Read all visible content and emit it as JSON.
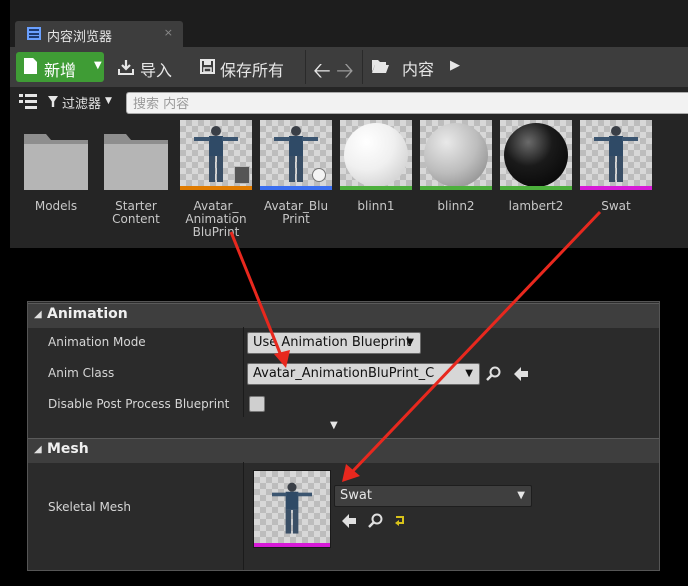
{
  "content_browser": {
    "tab_label": "内容浏览器",
    "tab_close": "×",
    "toolbar": {
      "new_label": "新增",
      "import_label": "导入",
      "save_all_label": "保存所有",
      "back_glyph": "🡠",
      "forward_glyph": "🡢",
      "breadcrumb_root": "内容",
      "breadcrumb_arrow": "▶"
    },
    "filterbar": {
      "filters_label": "过滤器",
      "search_placeholder": "搜索 内容"
    },
    "assets": [
      {
        "name": "Models",
        "kind": "folder"
      },
      {
        "name": "Starter Content",
        "kind": "folder"
      },
      {
        "name": "Avatar_ Animation BluPrint",
        "kind": "animation-blueprint",
        "underline_color": "#e07b00"
      },
      {
        "name": "Avatar_Blu Print",
        "kind": "blueprint",
        "underline_color": "#3a6ef0"
      },
      {
        "name": "blinn1",
        "kind": "material",
        "underline_color": "#4caf3c"
      },
      {
        "name": "blinn2",
        "kind": "material",
        "underline_color": "#4caf3c"
      },
      {
        "name": "lambert2",
        "kind": "material",
        "underline_color": "#4caf3c"
      },
      {
        "name": "Swat",
        "kind": "skeletal-mesh",
        "underline_color": "#d71ad7"
      }
    ]
  },
  "details": {
    "animation": {
      "header": "Animation",
      "mode_label": "Animation Mode",
      "mode_value": "Use Animation Blueprint",
      "anim_class_label": "Anim Class",
      "anim_class_value": "Avatar_AnimationBluPrint_C",
      "disable_pp_label": "Disable Post Process Blueprint",
      "disable_pp_checked": false
    },
    "mesh": {
      "header": "Mesh",
      "skeletal_mesh_label": "Skeletal Mesh",
      "skeletal_mesh_value": "Swat"
    }
  },
  "colors": {
    "accent_green": "#3f9c35",
    "annotation_arrow": "#e8281e"
  }
}
